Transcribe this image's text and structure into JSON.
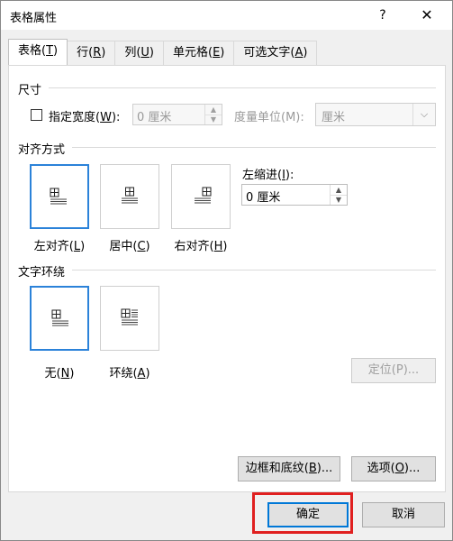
{
  "window": {
    "title": "表格属性",
    "help_label": "?",
    "close_label": "✕"
  },
  "tabs": [
    {
      "label": "表格(",
      "key": "T",
      "suffix": ")"
    },
    {
      "label": "行(",
      "key": "R",
      "suffix": ")"
    },
    {
      "label": "列(",
      "key": "U",
      "suffix": ")"
    },
    {
      "label": "单元格(",
      "key": "E",
      "suffix": ")"
    },
    {
      "label": "可选文字(",
      "key": "A",
      "suffix": ")"
    }
  ],
  "size": {
    "section": "尺寸",
    "width_checkbox_label": "指定宽度(",
    "width_checkbox_key": "W",
    "width_checkbox_suffix": "):",
    "width_value": "0 厘米",
    "unit_label": "度量单位(M):",
    "unit_value": "厘米"
  },
  "alignment": {
    "section": "对齐方式",
    "left": "左对齐(",
    "left_key": "L",
    "center": "居中(",
    "center_key": "C",
    "right": "右对齐(",
    "right_key": "H",
    "indent_label": "左缩进(",
    "indent_key": "I",
    "indent_suffix": "):",
    "indent_value": "0 厘米"
  },
  "wrap": {
    "section": "文字环绕",
    "none": "无(",
    "none_key": "N",
    "around": "环绕(",
    "around_key": "A",
    "position_button": "定位(P)..."
  },
  "buttons": {
    "borders": "边框和底纹(",
    "borders_key": "B",
    "borders_suffix": ")...",
    "options": "选项(",
    "options_key": "O",
    "options_suffix": ")...",
    "ok": "确定",
    "cancel": "取消"
  },
  "colors": {
    "accent": "#2b82d9",
    "highlight": "#e02020"
  }
}
